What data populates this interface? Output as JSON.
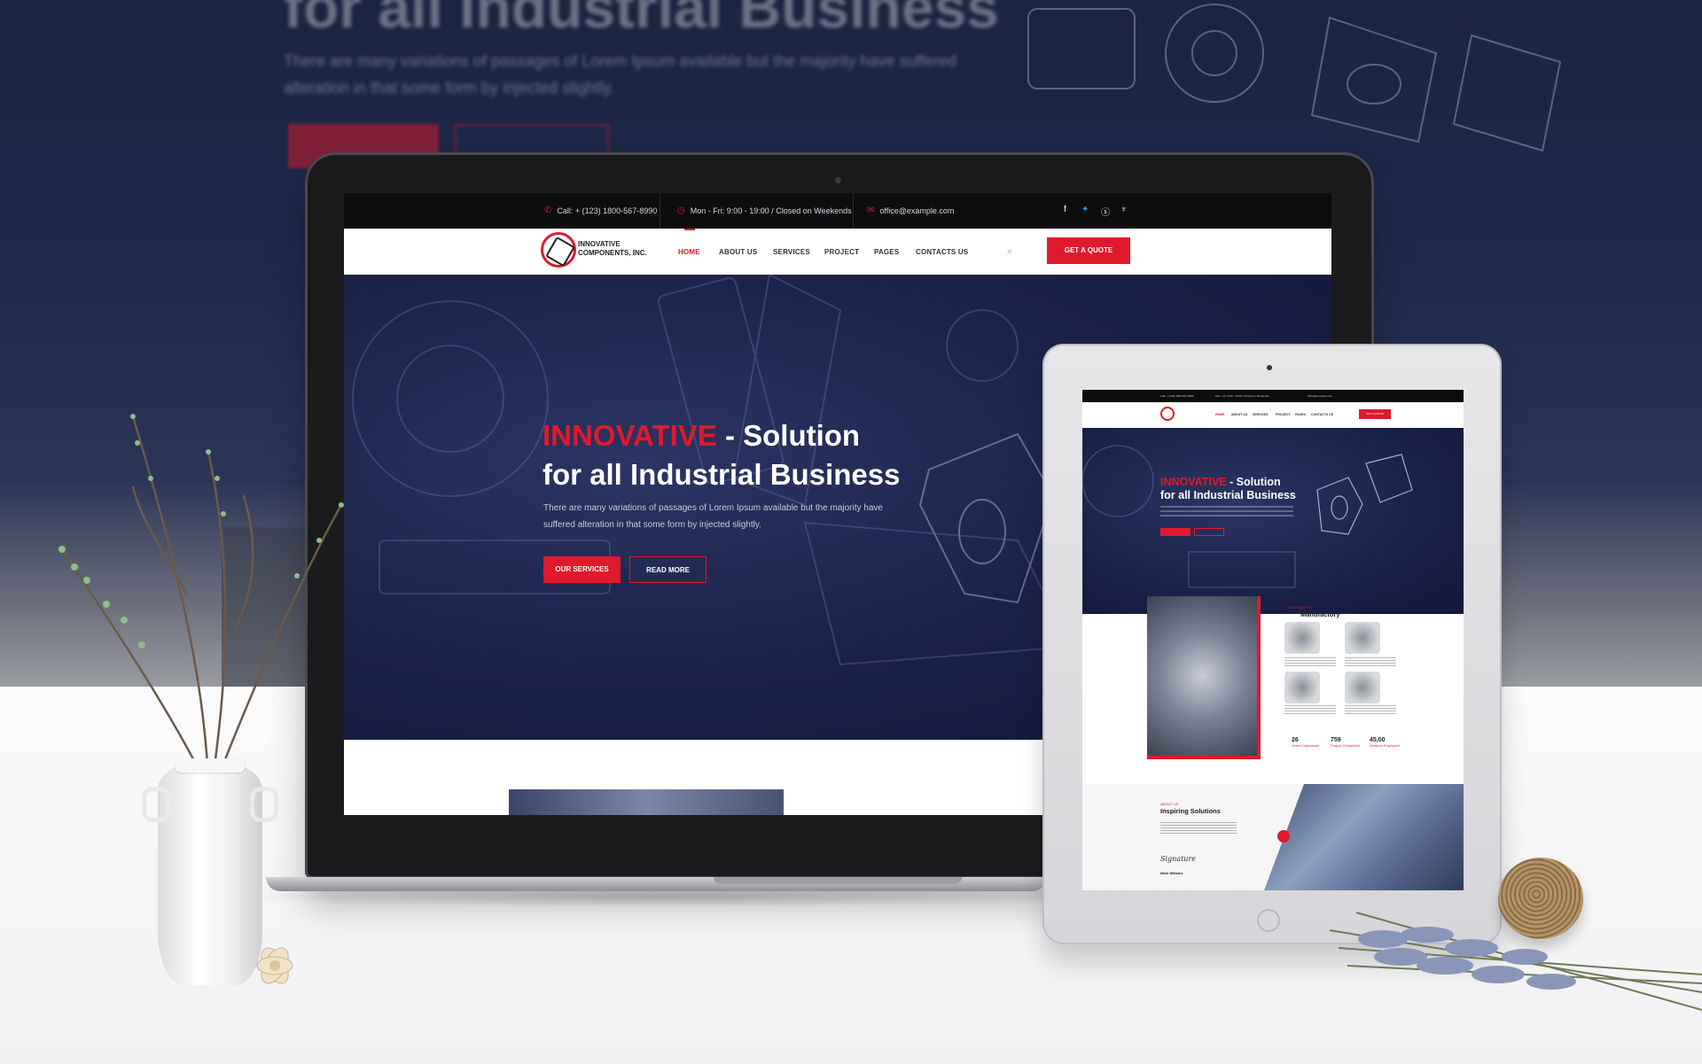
{
  "site": {
    "topbar": {
      "call": "Call: + (123) 1800-567-8990",
      "hours": "Mon - Fri: 9:00 - 19:00 / Closed on Weekends",
      "email": "office@example.com",
      "social": [
        "facebook-icon",
        "twitter-icon",
        "skype-icon",
        "vine-icon"
      ]
    },
    "logo": {
      "line1": "INNOVATIVE",
      "line2": "COMPONENTS, INC."
    },
    "nav": [
      "HOME",
      "ABOUT US",
      "SERVICES",
      "PROJECT",
      "PAGES",
      "CONTACTS US"
    ],
    "active_nav": "HOME",
    "quote_button": "GET A QUOTE",
    "hero": {
      "accent": "INNOVATIVE",
      "title_rest": " - Solution",
      "title_line2": "for all Industrial Business",
      "description": "There are many variations of passages of Lorem Ipsum available but the majority have suffered alteration in that some form by injected slightly.",
      "button_primary": "OUR SERVICES",
      "button_secondary": "READ MORE"
    }
  },
  "tablet": {
    "hero": {
      "accent": "INNOVATIVE",
      "title_rest": " - Solution",
      "title_line2": "for all Industrial Business"
    },
    "manufactory": {
      "kicker": "WELCOME TO",
      "title": "Manufactory"
    },
    "stats": [
      {
        "value": "26",
        "label": "Years Experience"
      },
      {
        "value": "759",
        "label": "Project Completed"
      },
      {
        "value": "45,00",
        "label": "Workers Employed"
      }
    ],
    "inspiring": {
      "kicker": "ABOUT US",
      "title": "Inspiring Solutions",
      "signature": "Signature",
      "name": "Mark Willams"
    }
  },
  "colors": {
    "accent": "#e01a2c",
    "navy": "#1a2147",
    "dark": "#0d0d10"
  }
}
